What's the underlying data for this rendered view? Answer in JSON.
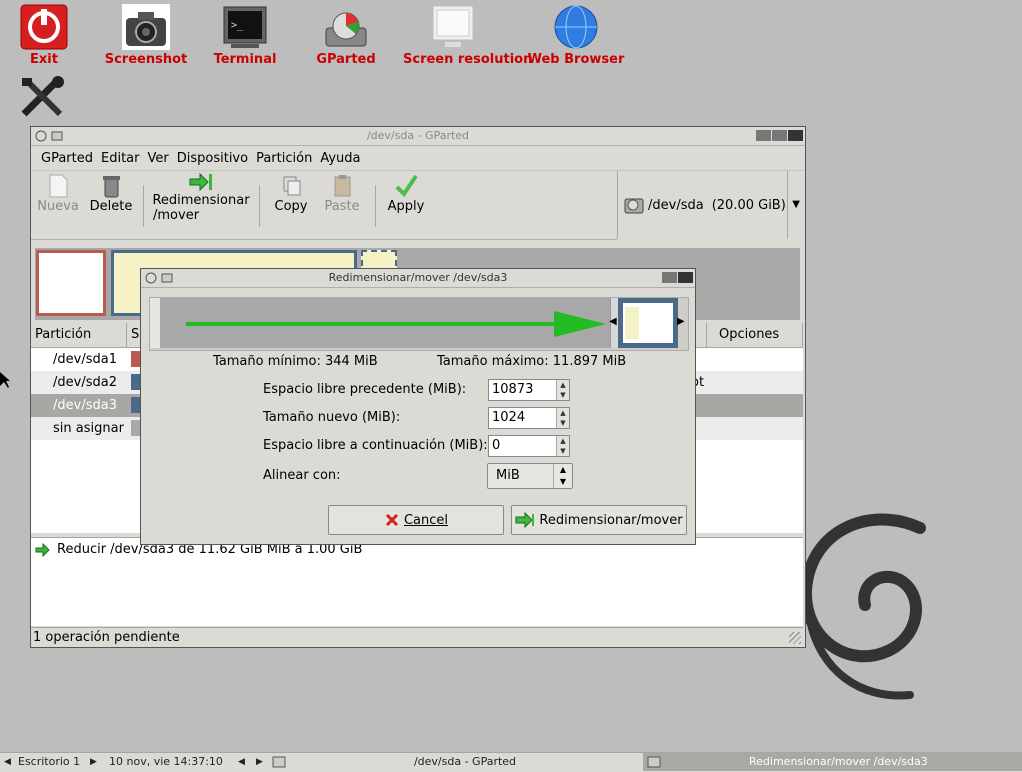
{
  "desktop": {
    "icons": [
      {
        "label": "Exit",
        "icon": "power-icon"
      },
      {
        "label": "Screenshot",
        "icon": "camera-icon"
      },
      {
        "label": "Terminal",
        "icon": "terminal-icon"
      },
      {
        "label": "GParted",
        "icon": "gparted-icon"
      },
      {
        "label": "Screen resolution",
        "icon": "monitor-icon"
      },
      {
        "label": "Web Browser",
        "icon": "globe-icon"
      }
    ]
  },
  "main_window": {
    "title": "/dev/sda - GParted",
    "menu": [
      "GParted",
      "Editar",
      "Ver",
      "Dispositivo",
      "Partición",
      "Ayuda"
    ],
    "toolbar": {
      "new_label": "Nueva",
      "delete_label": "Delete",
      "resize_label_1": "Redimensionar",
      "resize_label_2": "/mover",
      "copy_label": "Copy",
      "paste_label": "Paste",
      "apply_label": "Apply"
    },
    "device_selector": {
      "device": "/dev/sda",
      "size": "(20.00 GiB)"
    },
    "columns": {
      "partition": "Partición",
      "partial": "S",
      "options": "Opciones"
    },
    "partitions": [
      {
        "name": "/dev/sda1",
        "color": "#b85c50",
        "extra": ""
      },
      {
        "name": "/dev/sda2",
        "color": "#4a6a8a",
        "extra": "ot"
      },
      {
        "name": "/dev/sda3",
        "color": "#4a6a8a",
        "extra": ""
      },
      {
        "name": "sin asignar",
        "color": "#a8a8a8",
        "extra": ""
      }
    ],
    "pending_operation": "Reducir /dev/sda3 de 11.62 GiB MiB a 1.00 GiB",
    "status": "1 operación pendiente"
  },
  "dialog": {
    "title": "Redimensionar/mover /dev/sda3",
    "min_size": "Tamaño mínimo: 344 MiB",
    "max_size": "Tamaño máximo: 11.897 MiB",
    "fields": {
      "free_before_label": "Espacio libre precedente (MiB):",
      "free_before_value": "10873",
      "new_size_label": "Tamaño nuevo (MiB):",
      "new_size_value": "1024",
      "free_after_label": "Espacio libre a continuación (MiB):",
      "free_after_value": "0",
      "align_label": "Alinear con:",
      "align_value": "MiB"
    },
    "cancel_label": "Cancel",
    "resize_button_label": "Redimensionar/mover"
  },
  "taskbar": {
    "desktop": "Escritorio 1",
    "clock": "10 nov, vie 14:37:10",
    "task1": "/dev/sda - GParted",
    "task2": "Redimensionar/mover /dev/sda3"
  },
  "colors": {
    "desktop_label": "#cc0000",
    "arrow": "#22bb22",
    "partition_blue": "#4a6a8a",
    "selected_row": "#a9a7a3"
  }
}
